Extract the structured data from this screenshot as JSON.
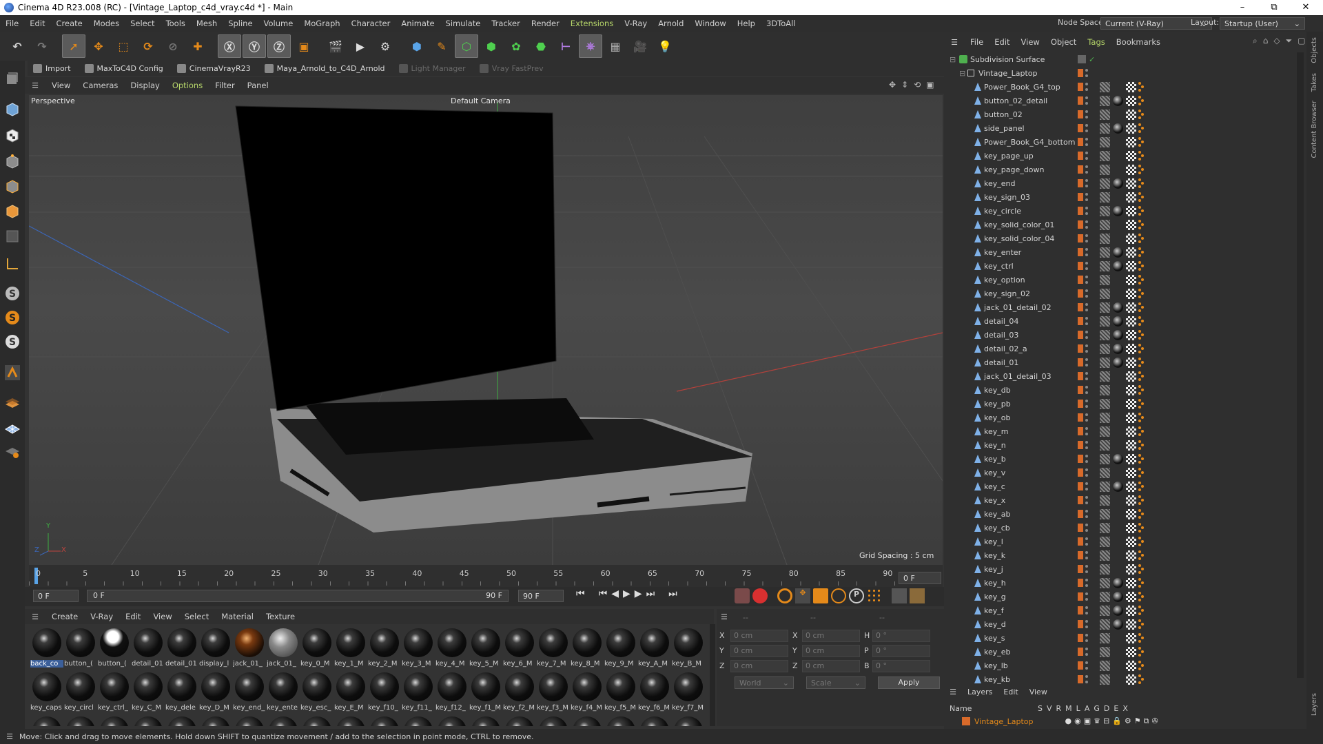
{
  "window": {
    "title": "Cinema 4D R23.008 (RC) - [Vintage_Laptop_c4d_vray.c4d *] - Main",
    "min": "–",
    "max": "⧉",
    "close": "✕"
  },
  "menu": [
    "File",
    "Edit",
    "Create",
    "Modes",
    "Select",
    "Tools",
    "Mesh",
    "Spline",
    "Volume",
    "MoGraph",
    "Character",
    "Animate",
    "Simulate",
    "Tracker",
    "Render",
    "Extensions",
    "V-Ray",
    "Arnold",
    "Window",
    "Help",
    "3DToAll"
  ],
  "node_space": {
    "label": "Node Space:",
    "value": "Current (V-Ray)"
  },
  "layout": {
    "label": "Layout:",
    "value": "Startup (User)"
  },
  "toolbar_icons": [
    "undo-icon",
    "redo-icon",
    "live-selection-icon",
    "move-icon",
    "scale-icon",
    "rotate-icon",
    "recent-tool-icon",
    "add-icon",
    "x-axis-icon",
    "y-axis-icon",
    "z-axis-icon",
    "coordinate-system-icon",
    "render-view-icon",
    "render-picture-viewer-icon",
    "render-settings-icon",
    "cube-icon",
    "pen-icon",
    "subdivision-icon",
    "extrude-icon",
    "cloner-icon",
    "boolean-icon",
    "measure-icon",
    "deformer-icon",
    "floor-icon",
    "camera-icon",
    "light-icon"
  ],
  "plugins": [
    {
      "label": "Import",
      "enabled": true
    },
    {
      "label": "MaxToC4D Config",
      "enabled": true
    },
    {
      "label": "CinemaVrayR23",
      "enabled": true
    },
    {
      "label": "Maya_Arnold_to_C4D_Arnold",
      "enabled": true
    },
    {
      "label": "Light Manager",
      "enabled": false
    },
    {
      "label": "Vray FastPrev",
      "enabled": false
    }
  ],
  "viewport_menu": [
    "View",
    "Cameras",
    "Display",
    "Options",
    "Filter",
    "Panel"
  ],
  "viewport": {
    "name": "Perspective",
    "camera": "Default Camera",
    "grid_spacing": "Grid Spacing : 5 cm",
    "axis": {
      "x": "X",
      "y": "Y",
      "z": "Z"
    }
  },
  "timeline": {
    "ticks": [
      "0",
      "5",
      "10",
      "15",
      "20",
      "25",
      "30",
      "35",
      "40",
      "45",
      "50",
      "55",
      "60",
      "65",
      "70",
      "75",
      "80",
      "85",
      "90"
    ],
    "current_frame": "0 F"
  },
  "transport": {
    "start": "0 F",
    "cur": "0 F",
    "end": "90 F",
    "end2": "90 F"
  },
  "material_menu": [
    "Create",
    "V-Ray",
    "Edit",
    "View",
    "Select",
    "Material",
    "Texture"
  ],
  "materials_row1": [
    "back_co",
    "button_(",
    "button_(",
    "detail_01",
    "detail_01",
    "display_l",
    "jack_01_",
    "jack_01_",
    "key_0_M",
    "key_1_M",
    "key_2_M",
    "key_3_M",
    "key_4_M",
    "key_5_M",
    "key_6_M",
    "key_7_M",
    "key_8_M",
    "key_9_M",
    "key_A_M",
    "key_B_M"
  ],
  "materials_row2": [
    "key_caps",
    "key_circl",
    "key_ctrl_",
    "key_C_M",
    "key_dele",
    "key_D_M",
    "key_end_",
    "key_ente",
    "key_esc_",
    "key_E_M",
    "key_f10_",
    "key_f11_",
    "key_f12_",
    "key_f1_M",
    "key_f2_M",
    "key_f3_M",
    "key_f4_M",
    "key_f5_M",
    "key_f6_M",
    "key_f7_M"
  ],
  "coords": {
    "headers": [
      "--",
      "--",
      "--"
    ],
    "rows": [
      {
        "a": "X",
        "av": "0 cm",
        "b": "X",
        "bv": "0 cm",
        "c": "H",
        "cv": "0 °"
      },
      {
        "a": "Y",
        "av": "0 cm",
        "b": "Y",
        "bv": "0 cm",
        "c": "P",
        "cv": "0 °"
      },
      {
        "a": "Z",
        "av": "0 cm",
        "b": "Z",
        "bv": "0 cm",
        "c": "B",
        "cv": "0 °"
      }
    ],
    "world": "World",
    "scale": "Scale",
    "apply": "Apply"
  },
  "object_menu": [
    "File",
    "Edit",
    "View",
    "Object",
    "Tags",
    "Bookmarks"
  ],
  "objects_root": "Subdivision Surface",
  "objects_group": "Vintage_Laptop",
  "objects": [
    "Power_Book_G4_top",
    "button_02_detail",
    "button_02",
    "side_panel",
    "Power_Book_G4_bottom",
    "key_page_up",
    "key_page_down",
    "key_end",
    "key_sign_03",
    "key_circle",
    "key_solid_color_01",
    "key_solid_color_04",
    "key_enter",
    "key_ctrl",
    "key_option",
    "key_sign_02",
    "jack_01_detail_02",
    "detail_04",
    "detail_03",
    "detail_02_a",
    "detail_01",
    "jack_01_detail_03",
    "key_db",
    "key_pb",
    "key_ob",
    "key_m",
    "key_n",
    "key_b",
    "key_v",
    "key_c",
    "key_x",
    "key_ab",
    "key_cb",
    "key_l",
    "key_k",
    "key_j",
    "key_h",
    "key_g",
    "key_f",
    "key_d",
    "key_s",
    "key_eb",
    "key_lb",
    "key_kb"
  ],
  "layers_menu": [
    "Layers",
    "Edit",
    "View"
  ],
  "layers_header": {
    "name": "Name",
    "cols": [
      "S",
      "V",
      "R",
      "M",
      "L",
      "A",
      "G",
      "D",
      "E",
      "X"
    ]
  },
  "layers_row": "Vintage_Laptop",
  "right_tabs": [
    "Objects",
    "Takes",
    "Content Browser",
    "Layers"
  ],
  "status": "Move: Click and drag to move elements. Hold down SHIFT to quantize movement / add to the selection in point mode, CTRL to remove."
}
